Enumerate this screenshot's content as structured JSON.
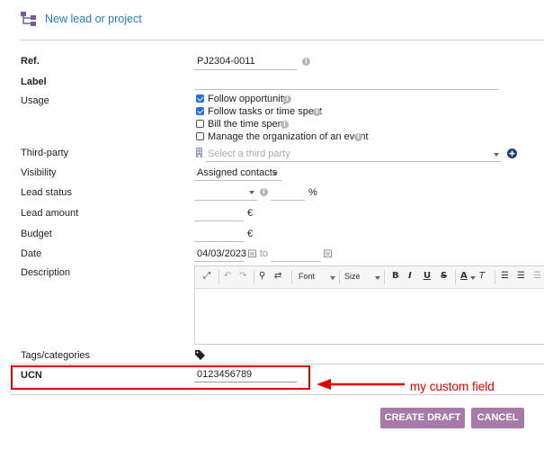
{
  "header": {
    "title": "New lead or project",
    "icon": "hierarchy-icon"
  },
  "fields": {
    "ref": {
      "label": "Ref.",
      "value": "PJ2304-0011"
    },
    "label": {
      "label": "Label",
      "value": ""
    },
    "usage": {
      "label": "Usage",
      "options": [
        {
          "text": "Follow opportunity",
          "checked": true
        },
        {
          "text": "Follow tasks or time spent",
          "checked": true
        },
        {
          "text": "Bill the time spent",
          "checked": false
        },
        {
          "text": "Manage the organization of an event",
          "checked": false
        }
      ]
    },
    "third_party": {
      "label": "Third-party",
      "placeholder": "Select a third party"
    },
    "visibility": {
      "label": "Visibility",
      "value": "Assigned contacts"
    },
    "lead_status": {
      "label": "Lead status",
      "unit": "%"
    },
    "lead_amount": {
      "label": "Lead amount",
      "unit": "€"
    },
    "budget": {
      "label": "Budget",
      "unit": "€"
    },
    "date": {
      "label": "Date",
      "value": "04/03/2023",
      "to_label": "to"
    },
    "description": {
      "label": "Description",
      "toolbar": {
        "font": "Font",
        "size": "Size",
        "bold": "B",
        "italic": "I",
        "underline": "U",
        "strike": "S",
        "textcolor": "A",
        "clearformat": "T"
      }
    },
    "tags": {
      "label": "Tags/categories"
    },
    "ucn": {
      "label": "UCN",
      "value": "0123456789"
    }
  },
  "buttons": {
    "create": "CREATE DRAFT",
    "cancel": "CANCEL"
  },
  "annotation": {
    "text": "my custom field",
    "color": "#e00000"
  },
  "colors": {
    "link": "#2a7fb0",
    "button": "#a87aa8",
    "checkbox": "#2b6fd6"
  }
}
